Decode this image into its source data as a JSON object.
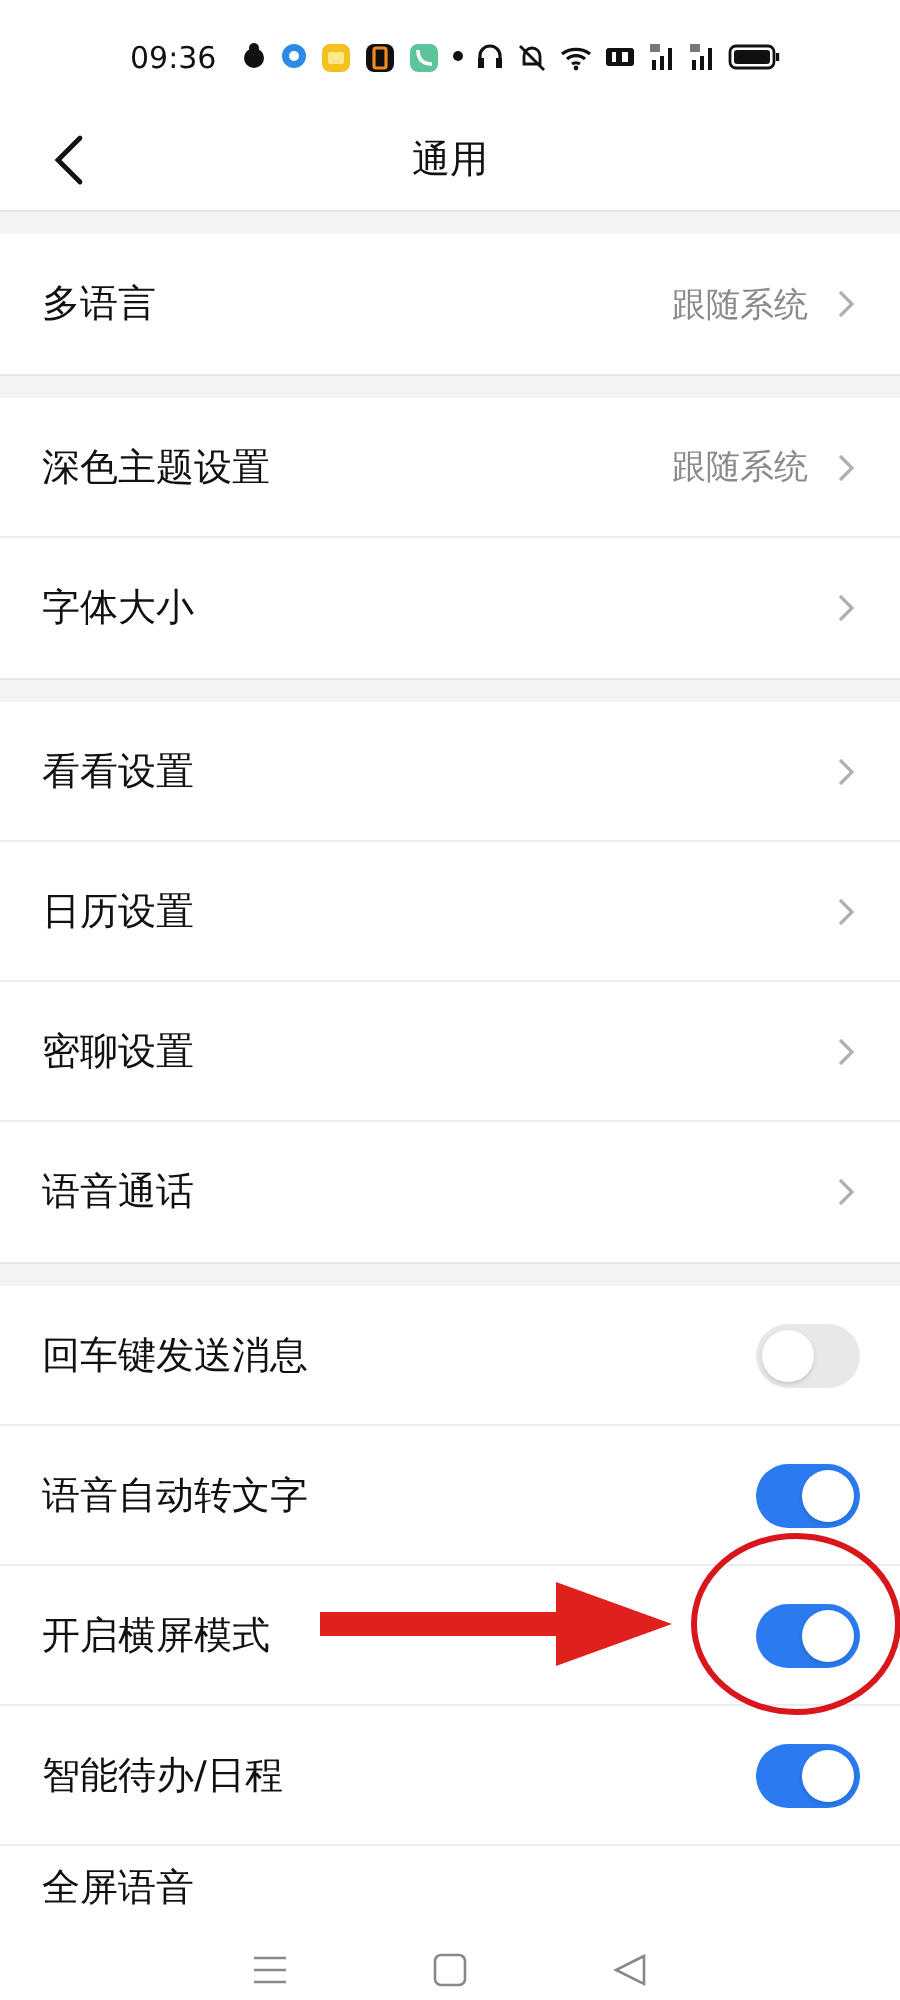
{
  "status_bar": {
    "time": "09:36"
  },
  "header": {
    "title": "通用"
  },
  "groups": [
    {
      "rows": [
        {
          "kind": "link",
          "label": "多语言",
          "value": "跟随系统"
        }
      ]
    },
    {
      "rows": [
        {
          "kind": "link",
          "label": "深色主题设置",
          "value": "跟随系统"
        },
        {
          "kind": "link",
          "label": "字体大小"
        }
      ]
    },
    {
      "rows": [
        {
          "kind": "link",
          "label": "看看设置"
        },
        {
          "kind": "link",
          "label": "日历设置"
        },
        {
          "kind": "link",
          "label": "密聊设置"
        },
        {
          "kind": "link",
          "label": "语音通话"
        }
      ]
    },
    {
      "rows": [
        {
          "kind": "toggle",
          "label": "回车键发送消息",
          "on": false
        },
        {
          "kind": "toggle",
          "label": "语音自动转文字",
          "on": true
        },
        {
          "kind": "toggle",
          "label": "开启横屏模式",
          "on": true
        },
        {
          "kind": "toggle",
          "label": "智能待办/日程",
          "on": true
        },
        {
          "kind": "partial",
          "label": "全屏语音"
        }
      ]
    }
  ]
}
